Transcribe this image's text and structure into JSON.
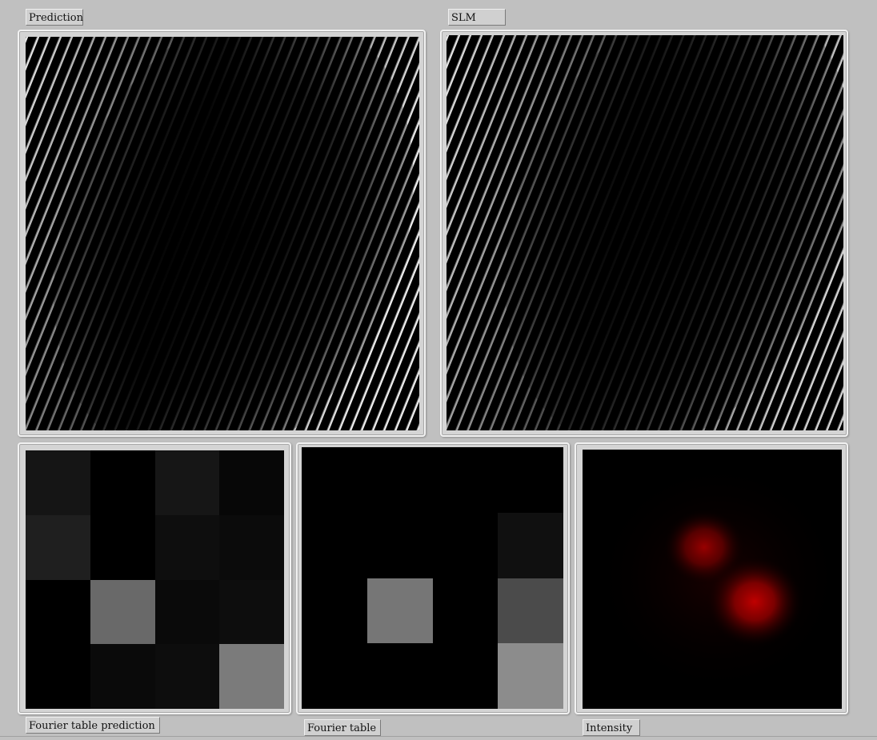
{
  "labels": {
    "prediction": "Prediction",
    "slm": "SLM",
    "fourier_prediction": "Fourier table prediction",
    "fourier_table": "Fourier table",
    "intensity": "Intensity"
  },
  "fourier_prediction_grid": [
    [
      21,
      0,
      22,
      7
    ],
    [
      31,
      0,
      14,
      11
    ],
    [
      0,
      105,
      10,
      13
    ],
    [
      0,
      10,
      13,
      123
    ]
  ],
  "fourier_table_grid": [
    [
      0,
      0,
      0,
      0
    ],
    [
      0,
      0,
      0,
      16
    ],
    [
      0,
      118,
      0,
      75
    ],
    [
      0,
      0,
      0,
      140
    ]
  ],
  "intensity_color": "#c00000"
}
